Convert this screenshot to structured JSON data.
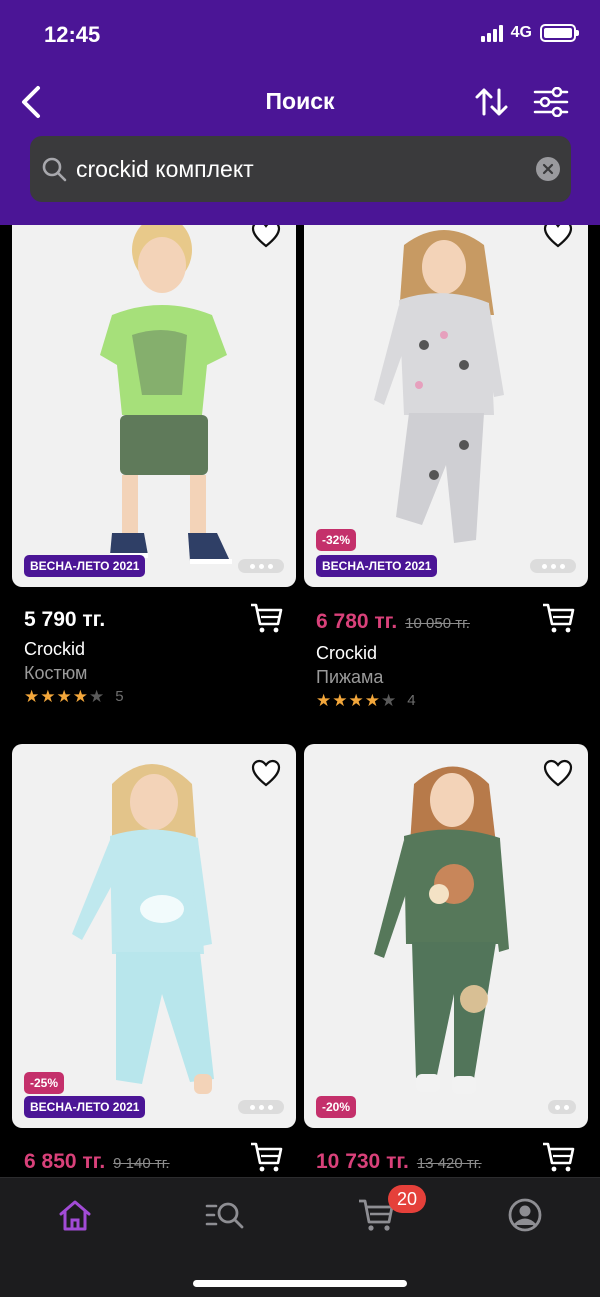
{
  "status_bar": {
    "time": "12:45",
    "network": "4G"
  },
  "header": {
    "title": "Поиск"
  },
  "search": {
    "query": "crockid комплект",
    "placeholder": ""
  },
  "products": [
    {
      "price": "5 790 тг.",
      "old_price": "",
      "brand": "Crockid",
      "type": "Костюм",
      "rating": 4,
      "reviews": "5",
      "discount": "",
      "season": "ВЕСНА-ЛЕТО 2021",
      "on_sale": false
    },
    {
      "price": "6 780 тг.",
      "old_price": "10 050 тг.",
      "brand": "Crockid",
      "type": "Пижама",
      "rating": 4,
      "reviews": "4",
      "discount": "-32%",
      "season": "ВЕСНА-ЛЕТО 2021",
      "on_sale": true
    },
    {
      "price": "6 850 тг.",
      "old_price": "9 140 тг.",
      "brand": "",
      "type": "",
      "rating": 0,
      "reviews": "",
      "discount": "-25%",
      "season": "ВЕСНА-ЛЕТО 2021",
      "on_sale": true
    },
    {
      "price": "10 730 тг.",
      "old_price": "13 420 тг.",
      "brand": "",
      "type": "",
      "rating": 0,
      "reviews": "",
      "discount": "-20%",
      "season": "",
      "on_sale": true
    }
  ],
  "tabbar": {
    "items": [
      "home-icon",
      "catalog-search-icon",
      "cart-icon",
      "profile-icon"
    ],
    "cart_count": "20",
    "active_color": "#a24bd6"
  },
  "colors": {
    "brand": "#4b1596",
    "sale_price": "#d9417a",
    "sale_badge": "#c4306b",
    "star": "#f3a73b"
  }
}
